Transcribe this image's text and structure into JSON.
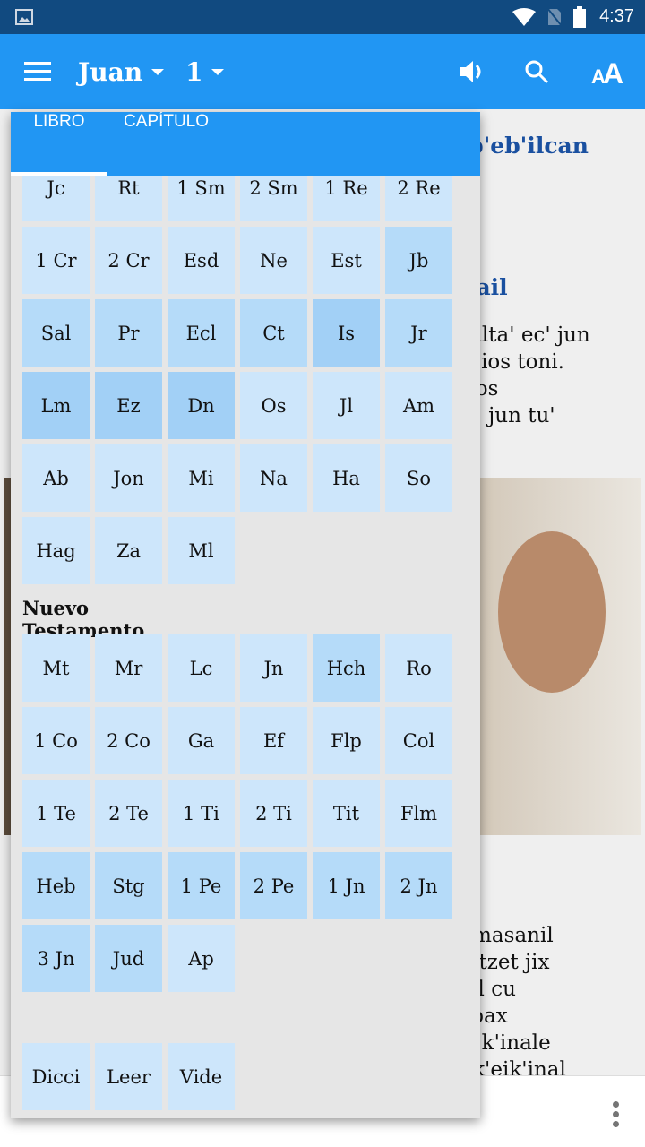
{
  "status_bar": {
    "time": "4:37",
    "icons": [
      "image-icon",
      "wifi-icon",
      "no-sim-icon",
      "battery-icon"
    ]
  },
  "toolbar": {
    "book": "Juan",
    "chapter": "1",
    "icons": [
      "menu-icon",
      "volume-icon",
      "search-icon",
      "font-size-icon"
    ]
  },
  "colors": {
    "primary": "#2196f3",
    "status": "#114a80",
    "tile_light": "#cde6fb",
    "tile_medium": "#b5dbf9",
    "tile_dark": "#a2d0f6",
    "heading": "#1a50a0"
  },
  "content": {
    "heading1": "'ib'eb'ilcan",
    "heading2": "mail",
    "para1": [
      "c'alta' ec' jun",
      "' Dios toni.",
      "Dios",
      "ec' jun tu'"
    ],
    "para2": [
      "n masanil",
      "ni tzet jix",
      "nal cu",
      "y pax",
      "sajk'inale",
      "u k'eik'inal"
    ]
  },
  "panel": {
    "tabs": [
      {
        "label": "LIBRO",
        "selected": true
      },
      {
        "label": "CAPÍTULO",
        "selected": false
      }
    ],
    "old_testament": [
      [
        "Jc",
        "l"
      ],
      [
        "Rt",
        "l"
      ],
      [
        "1 Sm",
        "l"
      ],
      [
        "2 Sm",
        "l"
      ],
      [
        "1 Re",
        "l"
      ],
      [
        "2 Re",
        "l"
      ],
      [
        "1 Cr",
        "l"
      ],
      [
        "2 Cr",
        "l"
      ],
      [
        "Esd",
        "l"
      ],
      [
        "Ne",
        "l"
      ],
      [
        "Est",
        "l"
      ],
      [
        "Jb",
        "m"
      ],
      [
        "Sal",
        "m"
      ],
      [
        "Pr",
        "m"
      ],
      [
        "Ecl",
        "m"
      ],
      [
        "Ct",
        "m"
      ],
      [
        "Is",
        "d"
      ],
      [
        "Jr",
        "m"
      ],
      [
        "Lm",
        "d"
      ],
      [
        "Ez",
        "d"
      ],
      [
        "Dn",
        "d"
      ],
      [
        "Os",
        "l"
      ],
      [
        "Jl",
        "l"
      ],
      [
        "Am",
        "l"
      ],
      [
        "Ab",
        "l"
      ],
      [
        "Jon",
        "l"
      ],
      [
        "Mi",
        "l"
      ],
      [
        "Na",
        "l"
      ],
      [
        "Ha",
        "l"
      ],
      [
        "So",
        "l"
      ],
      [
        "Hag",
        "l"
      ],
      [
        "Za",
        "l"
      ],
      [
        "Ml",
        "l"
      ]
    ],
    "nt_heading": "Nuevo Testamento",
    "new_testament": [
      [
        "Mt",
        "l"
      ],
      [
        "Mr",
        "l"
      ],
      [
        "Lc",
        "l"
      ],
      [
        "Jn",
        "l"
      ],
      [
        "Hch",
        "m"
      ],
      [
        "Ro",
        "l"
      ],
      [
        "1 Co",
        "l"
      ],
      [
        "2 Co",
        "l"
      ],
      [
        "Ga",
        "l"
      ],
      [
        "Ef",
        "l"
      ],
      [
        "Flp",
        "l"
      ],
      [
        "Col",
        "l"
      ],
      [
        "1 Te",
        "l"
      ],
      [
        "2 Te",
        "l"
      ],
      [
        "1 Ti",
        "l"
      ],
      [
        "2 Ti",
        "l"
      ],
      [
        "Tit",
        "l"
      ],
      [
        "Flm",
        "l"
      ],
      [
        "Heb",
        "m"
      ],
      [
        "Stg",
        "m"
      ],
      [
        "1 Pe",
        "m"
      ],
      [
        "2 Pe",
        "m"
      ],
      [
        "1 Jn",
        "m"
      ],
      [
        "2 Jn",
        "m"
      ],
      [
        "3 Jn",
        "m"
      ],
      [
        "Jud",
        "m"
      ],
      [
        "Ap",
        "l"
      ]
    ],
    "extras": [
      [
        "Dicci",
        "l"
      ],
      [
        "Leer",
        "l"
      ],
      [
        "Vide",
        "l"
      ]
    ]
  }
}
